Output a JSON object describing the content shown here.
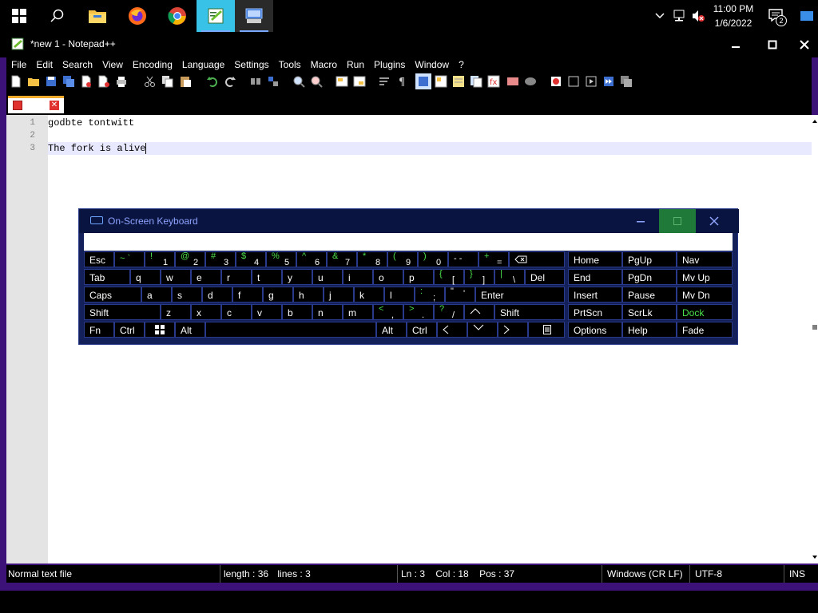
{
  "taskbar": {
    "clock_time": "11:00 PM",
    "clock_date": "1/6/2022",
    "notification_count": "2",
    "apps": [
      {
        "name": "file-explorer"
      },
      {
        "name": "firefox"
      },
      {
        "name": "chrome"
      },
      {
        "name": "notepad-plus-plus"
      },
      {
        "name": "on-screen-keyboard"
      }
    ]
  },
  "window": {
    "title": "*new 1 - Notepad++",
    "menu": [
      "File",
      "Edit",
      "Search",
      "View",
      "Encoding",
      "Language",
      "Settings",
      "Tools",
      "Macro",
      "Run",
      "Plugins",
      "Window",
      "?"
    ]
  },
  "editor": {
    "lines": [
      {
        "num": "1",
        "text": "godbte tontwitt"
      },
      {
        "num": "2",
        "text": ""
      },
      {
        "num": "3",
        "text": "The fork is alive"
      }
    ]
  },
  "status": {
    "file_type": "Normal text file",
    "length": "length : 36",
    "lines": "lines : 3",
    "ln": "Ln : 3",
    "col": "Col : 18",
    "pos": "Pos : 37",
    "eol": "Windows (CR LF)",
    "encoding": "UTF-8",
    "mode": "INS"
  },
  "osk": {
    "title": "On-Screen Keyboard",
    "row1": [
      {
        "main": "Esc"
      },
      {
        "sym": "~ `"
      },
      {
        "sym": "!",
        "low": "1"
      },
      {
        "sym": "@",
        "low": "2"
      },
      {
        "sym": "#",
        "low": "3"
      },
      {
        "sym": "$",
        "low": "4"
      },
      {
        "sym": "%",
        "low": "5"
      },
      {
        "sym": "^",
        "low": "6"
      },
      {
        "sym": "&",
        "low": "7"
      },
      {
        "sym": "*",
        "low": "8"
      },
      {
        "sym": "(",
        "low": "9"
      },
      {
        "sym": ")",
        "low": "0"
      },
      {
        "sym": "- -"
      },
      {
        "sym": "+",
        "low": "="
      },
      {
        "icon": "backspace-icon"
      }
    ],
    "row2": [
      "Tab",
      "q",
      "w",
      "e",
      "r",
      "t",
      "y",
      "u",
      "i",
      "o",
      "p"
    ],
    "row2_br_open": {
      "sym": "{",
      "low": "["
    },
    "row2_br_close": {
      "sym": "}",
      "low": "]"
    },
    "row2_pipe": {
      "sym": "|",
      "low": "\\"
    },
    "row2_del": "Del",
    "row3": [
      "Caps",
      "a",
      "s",
      "d",
      "f",
      "g",
      "h",
      "j",
      "k",
      "l"
    ],
    "row3_colon": {
      "sym": ":",
      "low": ";"
    },
    "row3_quote": {
      "sym": "\"",
      "low": "'"
    },
    "row3_enter": "Enter",
    "row4": [
      "Shift",
      "z",
      "x",
      "c",
      "v",
      "b",
      "n",
      "m"
    ],
    "row4_lt": {
      "sym": "<",
      "low": ","
    },
    "row4_gt": {
      "sym": ">",
      "low": "."
    },
    "row4_q": {
      "sym": "?",
      "low": "/"
    },
    "row4_shift_r": "Shift",
    "row5": {
      "fn": "Fn",
      "ctrl": "Ctrl",
      "alt": "Alt",
      "alt_r": "Alt",
      "ctrl_r": "Ctrl"
    },
    "side": [
      [
        "Home",
        "PgUp",
        "Nav"
      ],
      [
        "End",
        "PgDn",
        "Mv Up"
      ],
      [
        "Insert",
        "Pause",
        "Mv Dn"
      ],
      [
        "PrtScn",
        "ScrLk",
        "Dock"
      ],
      [
        "Options",
        "Help",
        "Fade"
      ]
    ]
  }
}
